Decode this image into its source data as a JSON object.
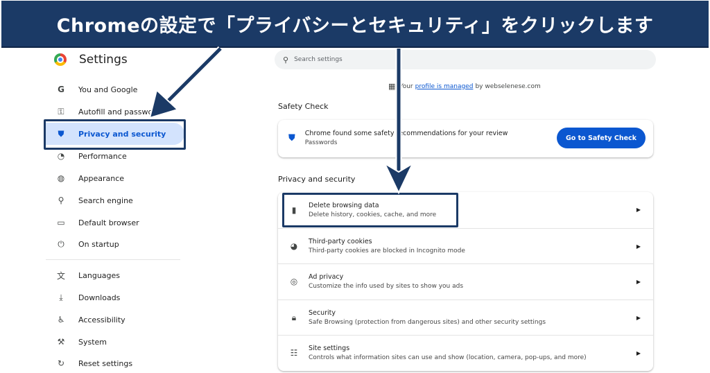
{
  "banner": {
    "text": "Chromeの設定で「プライバシーとセキュリティ」をクリックします"
  },
  "sidebar": {
    "title": "Settings",
    "items": [
      {
        "label": "You and Google",
        "icon": "google-g-icon",
        "glyph": "G"
      },
      {
        "label": "Autofill and passwords",
        "icon": "key-icon",
        "glyph": "⚿"
      },
      {
        "label": "Privacy and security",
        "icon": "shield-icon",
        "glyph": "⛊",
        "active": true
      },
      {
        "label": "Performance",
        "icon": "speedometer-icon",
        "glyph": "◔"
      },
      {
        "label": "Appearance",
        "icon": "palette-icon",
        "glyph": "◍"
      },
      {
        "label": "Search engine",
        "icon": "search-icon",
        "glyph": "⚲"
      },
      {
        "label": "Default browser",
        "icon": "browser-icon",
        "glyph": "▭"
      },
      {
        "label": "On startup",
        "icon": "power-icon",
        "glyph": "⏻"
      },
      {
        "label": "Languages",
        "icon": "translate-icon",
        "glyph": "文"
      },
      {
        "label": "Downloads",
        "icon": "download-icon",
        "glyph": "⤓"
      },
      {
        "label": "Accessibility",
        "icon": "accessibility-icon",
        "glyph": "♿"
      },
      {
        "label": "System",
        "icon": "wrench-icon",
        "glyph": "⚒"
      },
      {
        "label": "Reset settings",
        "icon": "reset-icon",
        "glyph": "↻"
      }
    ]
  },
  "search": {
    "placeholder": "Search settings",
    "icon": "search-icon"
  },
  "managed": {
    "prefix": "Your",
    "link": "profile is managed",
    "suffix": "by webselenese.com",
    "icon": "building-icon"
  },
  "safety": {
    "section_title": "Safety Check",
    "title": "Chrome found some safety recommendations for your review",
    "subtitle": "Passwords",
    "button": "Go to Safety Check",
    "icon": "shield-check-icon"
  },
  "privacy": {
    "section_title": "Privacy and security",
    "rows": [
      {
        "title": "Delete browsing data",
        "subtitle": "Delete history, cookies, cache, and more",
        "icon": "trash-icon",
        "glyph": "🗑"
      },
      {
        "title": "Third-party cookies",
        "subtitle": "Third-party cookies are blocked in Incognito mode",
        "icon": "cookie-icon",
        "glyph": "◕"
      },
      {
        "title": "Ad privacy",
        "subtitle": "Customize the info used by sites to show you ads",
        "icon": "ad-privacy-icon",
        "glyph": "◎"
      },
      {
        "title": "Security",
        "subtitle": "Safe Browsing (protection from dangerous sites) and other security settings",
        "icon": "lock-icon",
        "glyph": "🔒"
      },
      {
        "title": "Site settings",
        "subtitle": "Controls what information sites can use and show (location, camera, pop-ups, and more)",
        "icon": "sliders-icon",
        "glyph": "☷"
      }
    ]
  },
  "colors": {
    "banner": "#1b3a66",
    "accent": "#0b57d0",
    "active_bg": "#d3e3fd"
  }
}
